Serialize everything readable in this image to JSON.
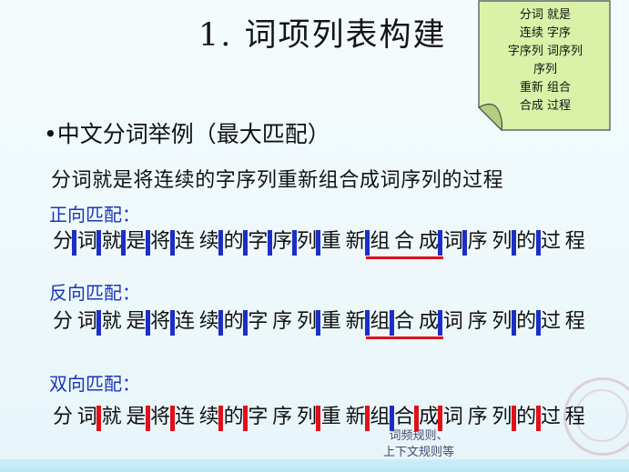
{
  "slide": {
    "title": "1. 词项列表构建",
    "note": {
      "lines": [
        "分词 就是",
        "连续 字序",
        "字序列 词序列",
        "序列",
        "重新 组合",
        "合成 过程"
      ]
    },
    "bullet_marker": "•",
    "bullet_text": "中文分词举例（最大匹配）",
    "sentence": "分词就是将连续的字序列重新组合成词序列的过程",
    "characters": [
      "分",
      "词",
      "就",
      "是",
      "将",
      "连",
      "续",
      "的",
      "字",
      "序",
      "列",
      "重",
      "新",
      "组",
      "合",
      "成",
      "词",
      "序",
      "列",
      "的",
      "过",
      "程"
    ],
    "sections": [
      {
        "label": "正向匹配：",
        "bars": [
          1,
          2,
          3,
          4,
          5,
          7,
          8,
          9,
          10,
          11,
          13,
          16,
          17,
          19,
          20
        ],
        "bar_colors": [
          "blue",
          "blue",
          "blue",
          "blue",
          "blue",
          "blue",
          "blue",
          "blue",
          "blue",
          "blue",
          "blue",
          "blue",
          "blue",
          "blue",
          "blue"
        ],
        "underline_chars": [
          13,
          15
        ]
      },
      {
        "label": "反向匹配：",
        "bars": [
          2,
          4,
          5,
          7,
          8,
          11,
          13,
          14,
          16,
          19,
          20
        ],
        "bar_colors": [
          "blue",
          "blue",
          "blue",
          "blue",
          "blue",
          "blue",
          "blue",
          "blue",
          "blue",
          "blue",
          "blue"
        ],
        "underline_chars": [
          13,
          15
        ]
      },
      {
        "label": "双向匹配：",
        "bars": [
          2,
          4,
          5,
          7,
          8,
          11,
          13,
          14,
          15,
          16,
          19,
          20
        ],
        "bar_colors": [
          "red",
          "red",
          "red",
          "red",
          "red",
          "red",
          "red",
          "blue",
          "red",
          "red",
          "red",
          "red"
        ],
        "underline_chars": null
      }
    ],
    "footnote": [
      "词频规则、",
      "上下文规则等"
    ],
    "colors": {
      "label": "#1b36b8",
      "blue_bar": "#1c2fc4",
      "red_bar": "#e0101a",
      "underline": "#e0101a",
      "note_fill": "#d9f2a8"
    }
  }
}
